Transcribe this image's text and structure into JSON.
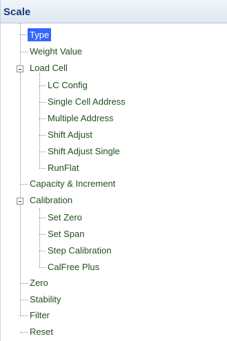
{
  "panel": {
    "title": "Scale"
  },
  "tree": {
    "type": "Type",
    "weight_value": "Weight Value",
    "load_cell": {
      "label": "Load Cell",
      "children": [
        "LC Config",
        "Single Cell Address",
        "Multiple Address",
        "Shift Adjust",
        "Shift Adjust Single",
        "RunFlat"
      ]
    },
    "capacity_increment": "Capacity & Increment",
    "calibration": {
      "label": "Calibration",
      "children": [
        "Set Zero",
        "Set Span",
        "Step Calibration",
        "CalFree Plus"
      ]
    },
    "zero": "Zero",
    "stability": "Stability",
    "filter": "Filter",
    "reset": "Reset"
  }
}
